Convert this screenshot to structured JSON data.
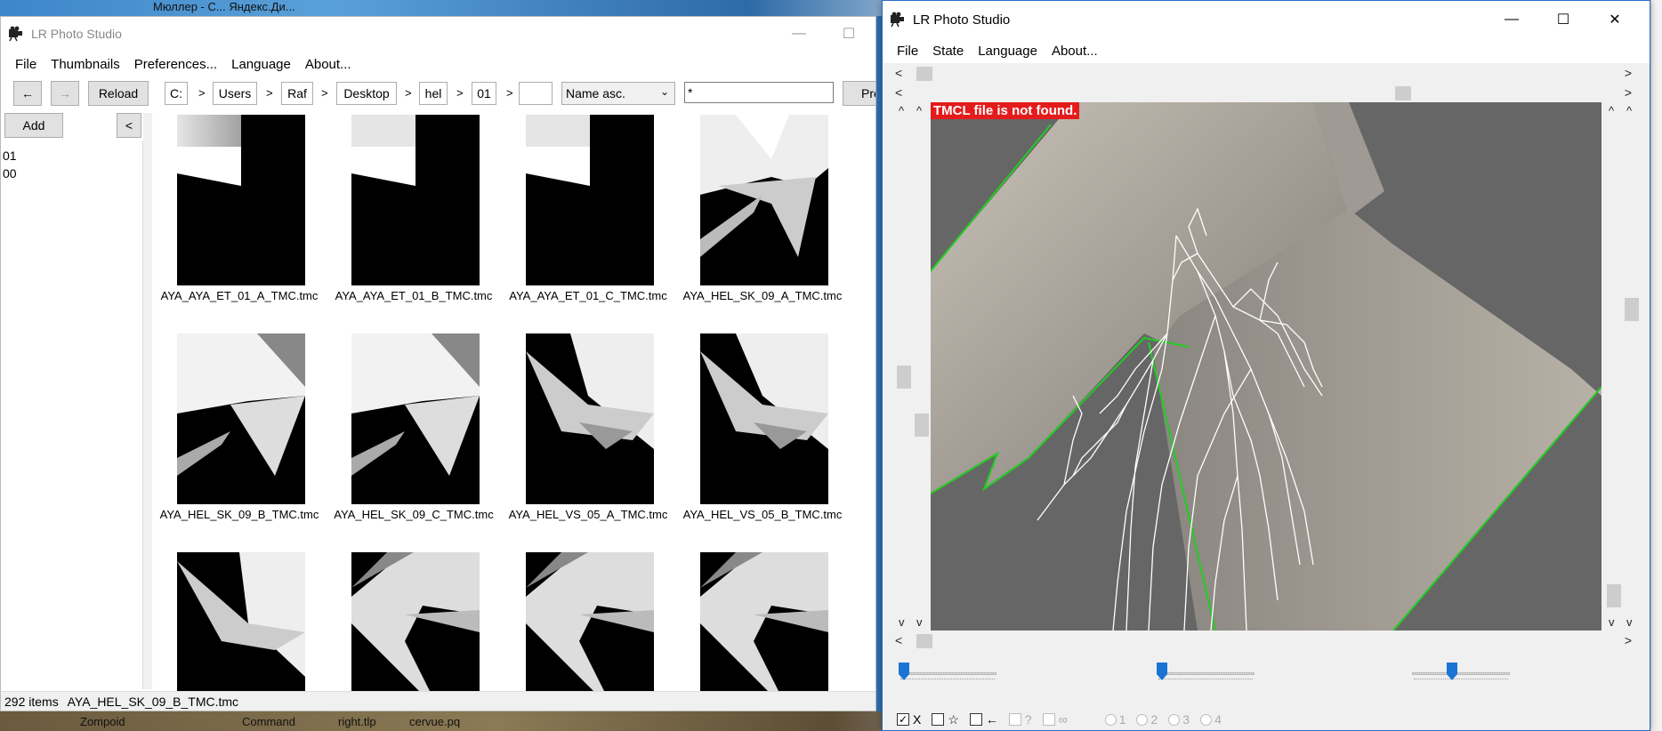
{
  "desktop": {
    "top_text": "Мюллер - С...   Яндекс.Ди...",
    "bottom_items": [
      "Zompoid",
      "Command",
      "right.tlp",
      "cervue.pq"
    ]
  },
  "left_window": {
    "title": "LR Photo Studio",
    "menu": [
      "File",
      "Thumbnails",
      "Preferences...",
      "Language",
      "About..."
    ],
    "toolbar": {
      "back": "←",
      "forward": "→",
      "reload": "Reload",
      "path": [
        "C:",
        "Users",
        "Raf",
        "Desktop",
        "hel",
        "01"
      ],
      "path_sep": ">",
      "sort": "Name asc.",
      "filter": "*",
      "preset_button": "Pres"
    },
    "add_button": "Add",
    "collapse_button": "<",
    "tree_items": [
      "01",
      "00"
    ],
    "thumbnails": [
      "AYA_AYA_ET_01_A_TMC.tmc",
      "AYA_AYA_ET_01_B_TMC.tmc",
      "AYA_AYA_ET_01_C_TMC.tmc",
      "AYA_HEL_SK_09_A_TMC.tmc",
      "AYA_HEL_SK_09_B_TMC.tmc",
      "AYA_HEL_SK_09_C_TMC.tmc",
      "AYA_HEL_VS_05_A_TMC.tmc",
      "AYA_HEL_VS_05_B_TMC.tmc",
      "",
      "",
      "",
      ""
    ],
    "status": {
      "count": "292 items",
      "selected": "AYA_HEL_SK_09_B_TMC.tmc"
    }
  },
  "right_window": {
    "title": "LR Photo Studio",
    "menu": [
      "File",
      "State",
      "Language",
      "About..."
    ],
    "error_banner": "TMCL file is not found.",
    "checkboxes": [
      {
        "label": "X",
        "checked": true,
        "enabled": true
      },
      {
        "label": "☆",
        "checked": false,
        "enabled": true
      },
      {
        "label": "←",
        "checked": false,
        "enabled": true
      },
      {
        "label": "?",
        "checked": false,
        "enabled": false
      },
      {
        "label": "∞",
        "checked": false,
        "enabled": false
      }
    ],
    "radios": [
      "1",
      "2",
      "3",
      "4"
    ],
    "sliders": [
      0.0,
      0.0,
      0.4
    ]
  },
  "colors": {
    "accent": "#1a74d4",
    "error": "#e51b1b",
    "wireframe": "#ffffff",
    "edge": "#22cc22"
  }
}
